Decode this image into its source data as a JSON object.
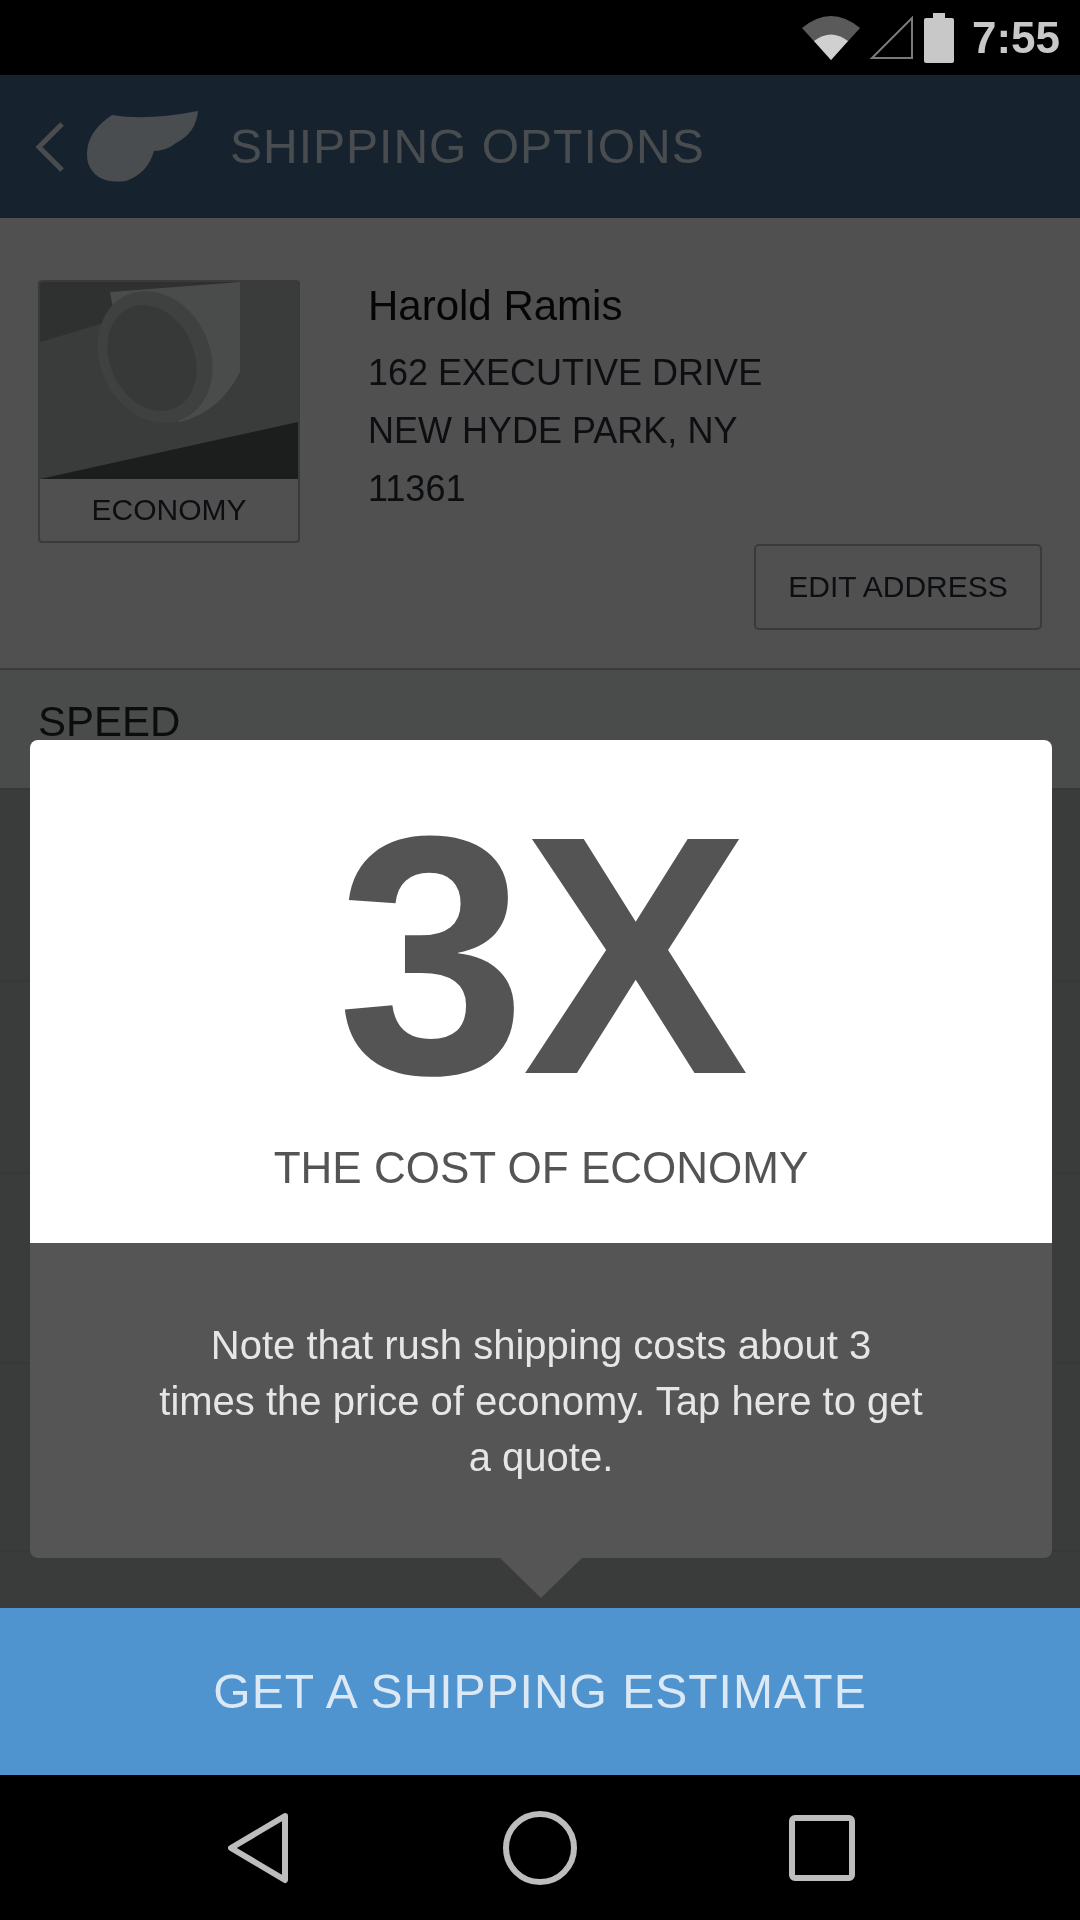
{
  "status_bar": {
    "time": "7:55"
  },
  "header": {
    "title": "SHIPPING OPTIONS"
  },
  "recipient": {
    "product_label": "ECONOMY",
    "name": "Harold Ramis",
    "address_lines": [
      "162 EXECUTIVE DRIVE",
      "NEW HYDE PARK, NY",
      "11361"
    ],
    "edit_button": "EDIT ADDRESS"
  },
  "section": {
    "title": "SPEED"
  },
  "tooltip": {
    "headline": "3X",
    "subtitle": "THE COST OF ECONOMY",
    "message": "Note that rush shipping costs about 3 times the price of economy. Tap here to get a quote."
  },
  "primary_button": "GET A SHIPPING ESTIMATE"
}
